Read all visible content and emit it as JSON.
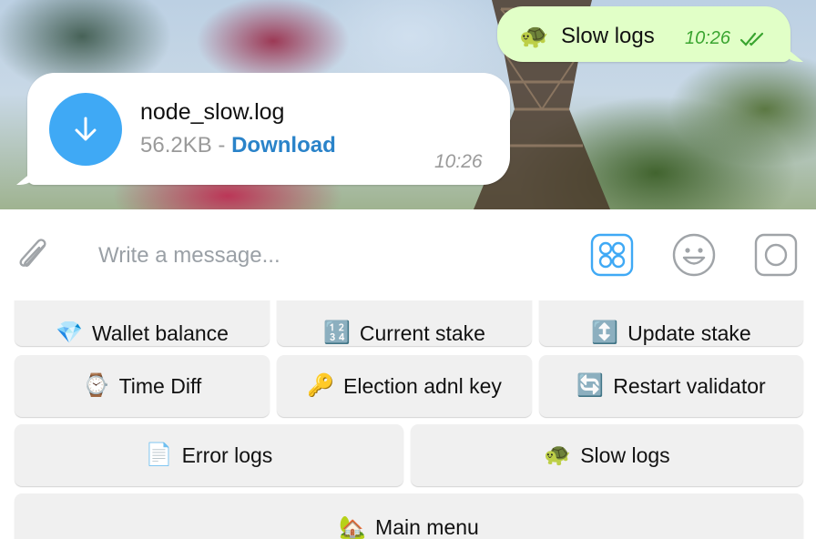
{
  "chat": {
    "outgoing": {
      "emoji": "🐢",
      "text": "Slow logs",
      "time": "10:26",
      "read_icon": "double-check-icon"
    },
    "incoming_file": {
      "icon": "download-arrow-icon",
      "file_name": "node_slow.log",
      "file_size": "56.2KB",
      "separator": "-",
      "download_label": "Download",
      "time": "10:26"
    }
  },
  "composer": {
    "placeholder": "Write a message...",
    "attach_icon": "paperclip-icon",
    "keyboard_icon": "bot-keyboard-icon",
    "emoji_icon": "smiley-icon",
    "camera_icon": "camera-icon"
  },
  "keyboard": {
    "rows": [
      [
        {
          "emoji": "💎",
          "label": "Wallet balance"
        },
        {
          "emoji": "🔢",
          "label": "Current stake"
        },
        {
          "emoji": "↕️",
          "label": "Update stake"
        }
      ],
      [
        {
          "emoji": "⌚",
          "label": "Time Diff"
        },
        {
          "emoji": "🔑",
          "label": "Election adnl key"
        },
        {
          "emoji": "🔄",
          "label": "Restart validator"
        }
      ],
      [
        {
          "emoji": "📄",
          "label": "Error logs"
        },
        {
          "emoji": "🐢",
          "label": "Slow logs"
        }
      ],
      [
        {
          "emoji": "🏡",
          "label": "Main menu"
        }
      ]
    ]
  },
  "colors": {
    "accent": "#3fa9f5",
    "link": "#2a83c9",
    "outgoing_bubble": "#e1ffc7",
    "outgoing_time": "#3aa530",
    "keyboard_button": "#f0f0f0"
  }
}
